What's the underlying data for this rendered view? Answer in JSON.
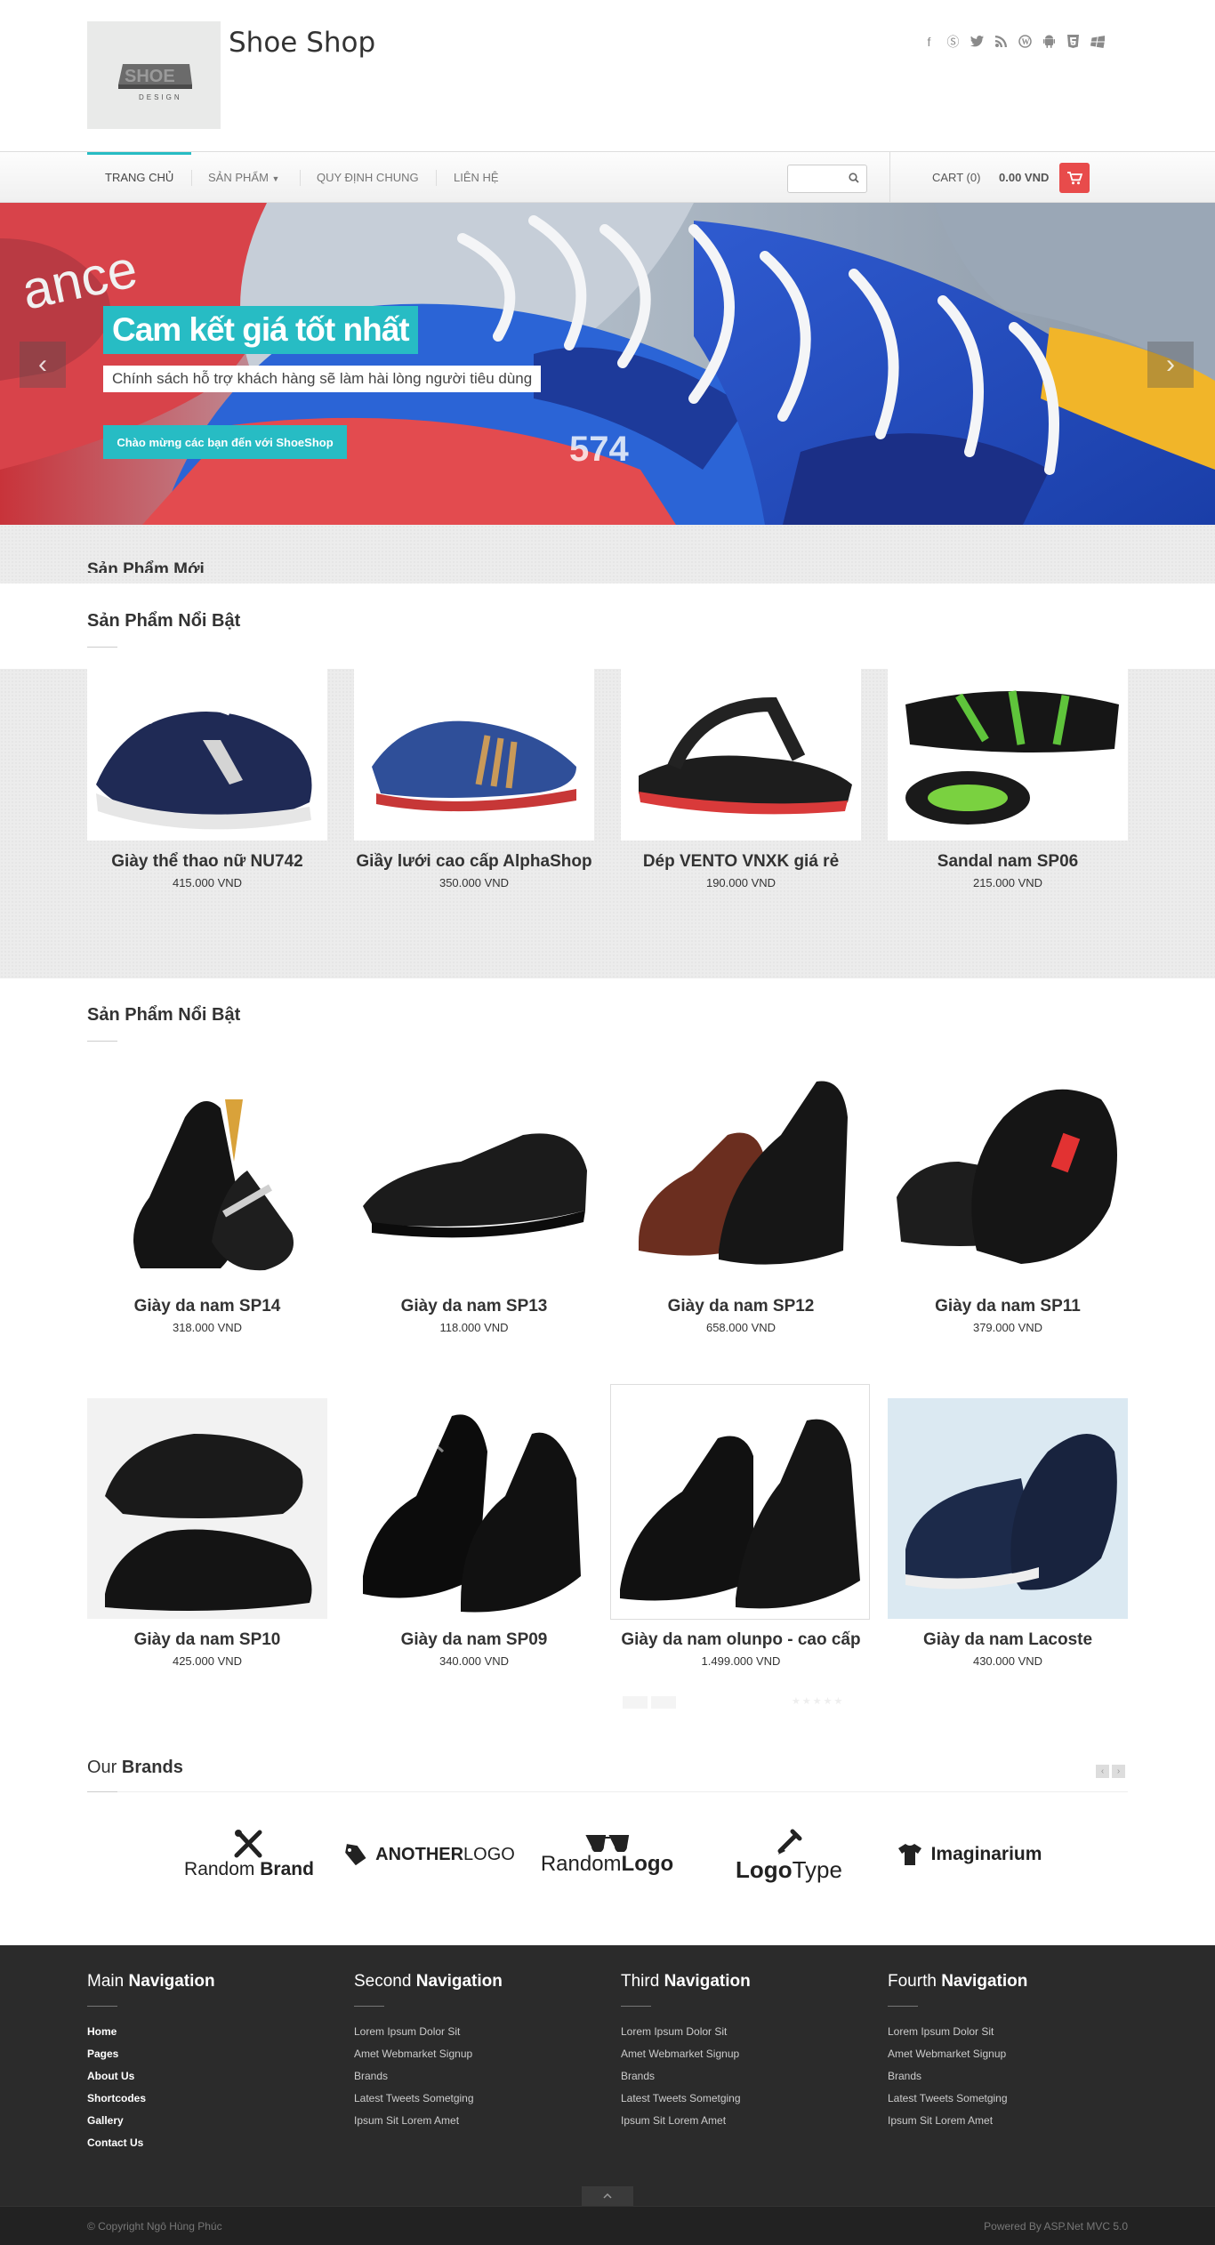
{
  "header": {
    "logo_text": "SHOE",
    "logo_sub": "DESIGN",
    "site_title": "Shoe Shop",
    "social_icons": [
      "facebook-icon",
      "skype-icon",
      "twitter-icon",
      "rss-icon",
      "wordpress-icon",
      "android-icon",
      "html5-icon",
      "windows-icon"
    ]
  },
  "nav": {
    "items": [
      {
        "label": "TRANG CHỦ"
      },
      {
        "label": "SẢN PHẨM"
      },
      {
        "label": "QUY ĐỊNH CHUNG"
      },
      {
        "label": "LIÊN HỆ"
      }
    ],
    "cart_label": "CART (0)",
    "cart_total": "0.00 VND"
  },
  "hero": {
    "headline": "Cam kết giá tốt nhất",
    "subtitle": "Chính sách hỗ trợ khách hàng sẽ làm hài lòng người tiêu dùng",
    "button": "Chào mừng các bạn đến với ShoeShop"
  },
  "section_new": {
    "title_cut": "Sản Phẩm Mới"
  },
  "section_featured1": {
    "title": "Sản Phẩm Nổi Bật",
    "products": [
      {
        "name": "Giày thể thao nữ NU742",
        "price": "415.000 VND"
      },
      {
        "name": "Giầy lưới cao cấp AlphaShop",
        "price": "350.000 VND"
      },
      {
        "name": "Dép VENTO VNXK giá rẻ",
        "price": "190.000 VND"
      },
      {
        "name": "Sandal nam SP06",
        "price": "215.000 VND"
      }
    ]
  },
  "section_featured2": {
    "title": "Sản Phẩm Nổi Bật",
    "products": [
      {
        "name": "Giày da nam SP14",
        "price": "318.000 VND"
      },
      {
        "name": "Giày da nam SP13",
        "price": "118.000 VND"
      },
      {
        "name": "Giày da nam SP12",
        "price": "658.000 VND"
      },
      {
        "name": "Giày da nam SP11",
        "price": "379.000 VND"
      },
      {
        "name": "Giày da nam SP10",
        "price": "425.000 VND"
      },
      {
        "name": "Giày da nam SP09",
        "price": "340.000 VND"
      },
      {
        "name": "Giày da nam olunpo - cao cấp",
        "price": "1.499.000 VND"
      },
      {
        "name": "Giày da nam Lacoste",
        "price": "430.000 VND"
      }
    ]
  },
  "brands": {
    "title_light": "Our",
    "title_bold": "Brands",
    "items": [
      {
        "light": "Random",
        "bold": "Brand"
      },
      {
        "light": "",
        "bold": "ANOTHER",
        "tail": "LOGO"
      },
      {
        "light": "Random",
        "bold": "Logo"
      },
      {
        "light": "Type",
        "bold": "Logo"
      },
      {
        "light": "",
        "bold": "Imaginarium"
      }
    ]
  },
  "footer": {
    "columns": [
      {
        "light": "Main",
        "bold": "Navigation",
        "links": [
          "Home",
          "Pages",
          "About Us",
          "Shortcodes",
          "Gallery",
          "Contact Us"
        ]
      },
      {
        "light": "Second",
        "bold": "Navigation",
        "links": [
          "Lorem Ipsum Dolor Sit",
          "Amet Webmarket Signup",
          "Brands",
          "Latest Tweets Sometging",
          "Ipsum Sit Lorem Amet"
        ]
      },
      {
        "light": "Third",
        "bold": "Navigation",
        "links": [
          "Lorem Ipsum Dolor Sit",
          "Amet Webmarket Signup",
          "Brands",
          "Latest Tweets Sometging",
          "Ipsum Sit Lorem Amet"
        ]
      },
      {
        "light": "Fourth",
        "bold": "Navigation",
        "links": [
          "Lorem Ipsum Dolor Sit",
          "Amet Webmarket Signup",
          "Brands",
          "Latest Tweets Sometging",
          "Ipsum Sit Lorem Amet"
        ]
      }
    ],
    "copyright": "© Copyright Ngô Hùng Phúc",
    "powered": "Powered By ASP.Net MVC 5.0"
  },
  "colors": {
    "accent": "#27bcc4",
    "cart": "#e84b4b",
    "footer_bg": "#2b2b2b"
  }
}
